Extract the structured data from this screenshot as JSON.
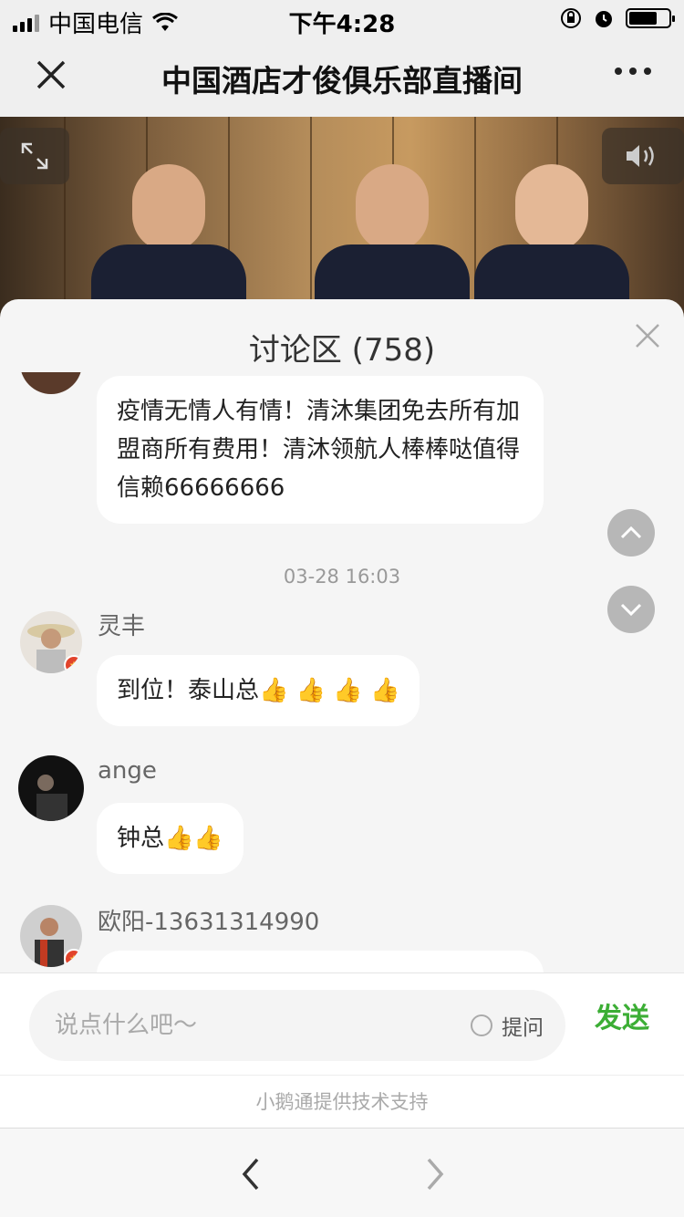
{
  "status_bar": {
    "carrier": "中国电信",
    "time": "下午4:28"
  },
  "navbar": {
    "title": "中国酒店才俊俱乐部直播间"
  },
  "video": {
    "colors": {
      "wall": "#b48c5a",
      "suit": "#1b2033"
    }
  },
  "discussion": {
    "title": "讨论区 (758)",
    "messages": [
      {
        "name": "",
        "text": "疫情无情人有情！清沐集团免去所有加盟商所有费用！清沐领航人棒棒哒值得信赖66666666"
      },
      {
        "name": "灵丰",
        "text": "到位！泰山总",
        "thumbs": 4
      },
      {
        "name": "ange",
        "text": "钟总",
        "thumbs": 2
      },
      {
        "name": "欧阳-13631314990",
        "text": ""
      }
    ],
    "timestamp": "03-28 16:03"
  },
  "input": {
    "placeholder": "说点什么吧～",
    "ask_label": "提问",
    "send_label": "发送"
  },
  "footer": {
    "support_text": "小鹅通提供技术支持"
  },
  "colors": {
    "accent_green": "#3cae35",
    "background": "#efefef"
  }
}
